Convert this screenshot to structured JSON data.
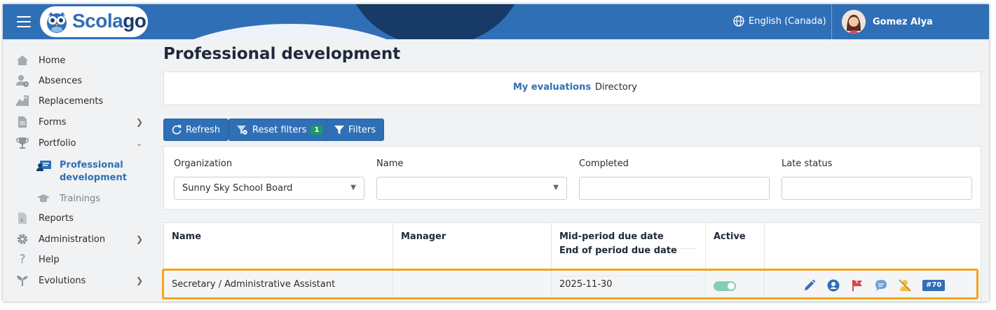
{
  "topbar": {
    "brand_main": "Scola",
    "brand_accent": "go",
    "language": "English (Canada)",
    "user_name": "Gomez Alya"
  },
  "sidebar": {
    "items": [
      {
        "label": "Home",
        "icon": "home-icon"
      },
      {
        "label": "Absences",
        "icon": "absence-icon"
      },
      {
        "label": "Replacements",
        "icon": "replacement-icon"
      },
      {
        "label": "Forms",
        "icon": "forms-icon",
        "expandable": true
      },
      {
        "label": "Portfolio",
        "icon": "trophy-icon",
        "expanded": true
      },
      {
        "label": "Reports",
        "icon": "reports-icon"
      },
      {
        "label": "Administration",
        "icon": "gear-icon",
        "expandable": true
      },
      {
        "label": "Help",
        "icon": "help-icon"
      },
      {
        "label": "Evolutions",
        "icon": "sprout-icon",
        "expandable": true
      }
    ],
    "subitems": [
      {
        "label": "Professional development",
        "active": true
      },
      {
        "label": "Trainings",
        "active": false
      }
    ]
  },
  "page": {
    "title": "Professional development",
    "tabs": [
      {
        "label": "My evaluations",
        "active": true
      },
      {
        "label": "Directory",
        "active": false
      }
    ]
  },
  "toolbar": {
    "refresh_label": "Refresh",
    "reset_label": "Reset filters",
    "reset_count": "1",
    "filters_label": "Filters"
  },
  "filters": {
    "organization_label": "Organization",
    "organization_value": "Sunny Sky School Board",
    "name_label": "Name",
    "name_value": "",
    "completed_label": "Completed",
    "completed_value": "",
    "late_label": "Late status",
    "late_value": ""
  },
  "table": {
    "headers": {
      "name": "Name",
      "manager": "Manager",
      "due_mid": "Mid-period due date",
      "due_end": "End of period due date",
      "active": "Active"
    },
    "rows": [
      {
        "name": "Secretary / Administrative Assistant",
        "manager": "",
        "due_mid": "",
        "due_end": "2025-11-30",
        "active": true,
        "id_badge": "#70"
      }
    ]
  },
  "colors": {
    "primary": "#2f6fb6",
    "dark_navy": "#173b66",
    "success": "#1f9a60",
    "highlight": "#f5a318",
    "flag_red": "#e0404a",
    "toggle_on": "#85cdb7"
  }
}
